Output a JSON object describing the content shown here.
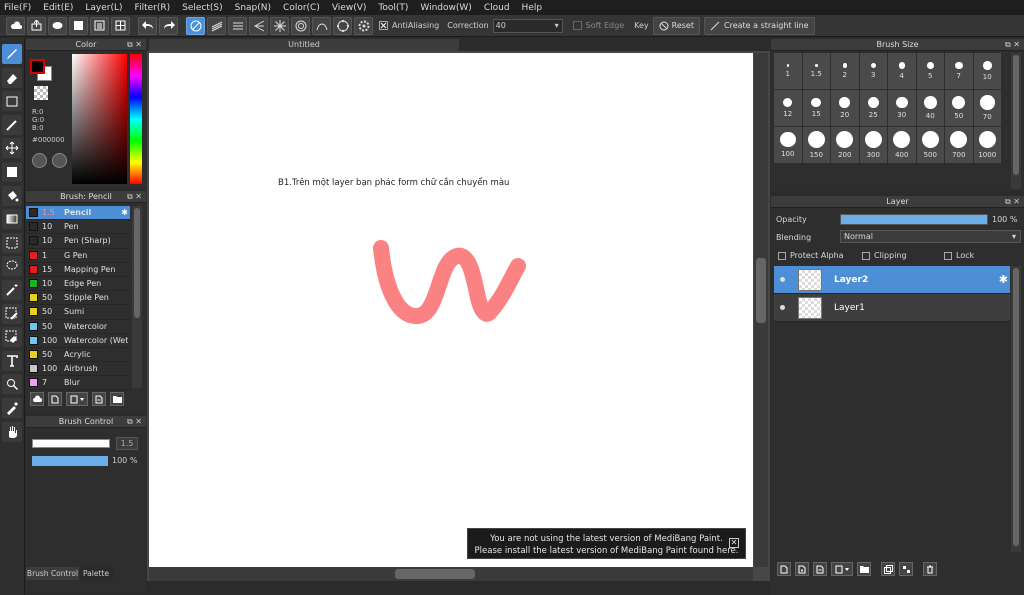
{
  "menu": [
    "File(F)",
    "Edit(E)",
    "Layer(L)",
    "Filter(R)",
    "Select(S)",
    "Snap(N)",
    "Color(C)",
    "View(V)",
    "Tool(T)",
    "Window(W)",
    "Cloud",
    "Help"
  ],
  "toolbar": {
    "antialiasing_label": "AntiAliasing",
    "correction_label": "Correction",
    "correction_value": "40",
    "soft_edge_label": "Soft Edge",
    "key_label": "Key",
    "reset_label": "Reset",
    "straight_line_label": "Create a straight line"
  },
  "color_panel": {
    "title": "Color",
    "r": "R:0",
    "g": "G:0",
    "b": "B:0",
    "hex": "#000000",
    "fg_color": "#000000",
    "bg_color": "#ffffff"
  },
  "brush_panel": {
    "title": "Brush: Pencil",
    "items": [
      {
        "size": "1.5",
        "name": "Pencil",
        "color": "#2a2a2a"
      },
      {
        "size": "10",
        "name": "Pen",
        "color": "#2a2a2a"
      },
      {
        "size": "10",
        "name": "Pen (Sharp)",
        "color": "#2a2a2a"
      },
      {
        "size": "1",
        "name": "G Pen",
        "color": "#e02020"
      },
      {
        "size": "15",
        "name": "Mapping Pen",
        "color": "#e02020"
      },
      {
        "size": "10",
        "name": "Edge Pen",
        "color": "#20b020"
      },
      {
        "size": "50",
        "name": "Stipple Pen",
        "color": "#e8d020"
      },
      {
        "size": "50",
        "name": "Sumi",
        "color": "#e8d020"
      },
      {
        "size": "50",
        "name": "Watercolor",
        "color": "#70c8f0"
      },
      {
        "size": "100",
        "name": "Watercolor (Wet)",
        "color": "#70c8f0"
      },
      {
        "size": "50",
        "name": "Acrylic",
        "color": "#e8d020"
      },
      {
        "size": "100",
        "name": "Airbrush",
        "color": "#c8c8c8"
      },
      {
        "size": "7",
        "name": "Blur",
        "color": "#f0a0f0"
      }
    ]
  },
  "brush_control": {
    "title": "Brush Control",
    "size_value": "1.5",
    "opacity_value": "100 %",
    "tab_brush_control": "Brush Control",
    "tab_palette": "Palette"
  },
  "document": {
    "title": "Untitled",
    "canvas_text": "B1.Trên một layer bạn phác form chữ cần chuyển màu",
    "stroke_color": "#fa8282"
  },
  "brush_size_panel": {
    "title": "Brush Size",
    "sizes": [
      "1",
      "1.5",
      "2",
      "3",
      "4",
      "5",
      "7",
      "10",
      "12",
      "15",
      "20",
      "25",
      "30",
      "40",
      "50",
      "70",
      "100",
      "150",
      "200",
      "300",
      "400",
      "500",
      "700",
      "1000"
    ]
  },
  "layer_panel": {
    "title": "Layer",
    "opacity_label": "Opacity",
    "opacity_value": "100 %",
    "opacity_fraction": 1.0,
    "blending_label": "Blending",
    "blending_value": "Normal",
    "protect_alpha_label": "Protect Alpha",
    "clipping_label": "Clipping",
    "lock_label": "Lock",
    "layers": [
      {
        "name": "Layer2",
        "selected": true
      },
      {
        "name": "Layer1",
        "selected": false
      }
    ]
  },
  "notice": {
    "line1": "You are not using the latest version of MediBang Paint.",
    "line2": "Please install the latest version of MediBang Paint found here."
  },
  "accent_color": "#4d8fd6"
}
